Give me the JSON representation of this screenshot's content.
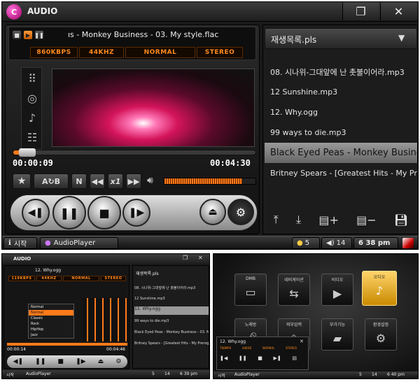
{
  "window": {
    "title": "AUDIO",
    "restore_icon": "restore-icon",
    "close_icon": "close-icon",
    "logo_text": "C"
  },
  "player": {
    "marquee": "ıs - Monkey Business - 03. My style.flac",
    "bitrate": "860KBPS",
    "samplerate": "44KHZ",
    "eq": "NORMAL",
    "channel": "STEREO",
    "time_elapsed": "00:00:09",
    "time_total": "00:04:30",
    "progress": 0.035,
    "volume": 0.85,
    "repeat_label": "A↻B",
    "n_label": "N",
    "speed_label": "x1"
  },
  "playlist": {
    "name": "재생목록.pls",
    "items": [
      "08. 시나위-그대앞에 난 촛불이어라.mp3",
      "12 Sunshine.mp3",
      "12. Why.ogg",
      "99 ways to die.mp3",
      "Black Eyed Peas - Monkey Business",
      "Britney Spears - [Greatest Hits - My Prerogative"
    ],
    "selected_index": 4
  },
  "taskbar": {
    "start": "시작",
    "app": "AudioPlayer",
    "signal": "5",
    "volume": "14",
    "clock": "6 38 pm"
  },
  "small": {
    "title": "AUDIO",
    "marquee": "12. Why.ogg",
    "bitrate": "119KBPS",
    "samplerate": "44KHZ",
    "eq": "NORMAL",
    "channel": "STEREO",
    "eq_menu": [
      "Normal",
      "Normal",
      "Classic",
      "Rock",
      "HipHop",
      "Jazz"
    ],
    "time_elapsed": "00:00:14",
    "time_total": "00:04:46",
    "playlist_name": "재생목록.pls",
    "playlist_items": [
      "08. 시나위-그대앞에 난 촛불이어라.mp3",
      "12 Sunshine.mp3",
      "12. Why.ogg",
      "99 ways to die.mp3",
      "Black Eyed Peas - Monkey Business - 03. My st",
      "Britney Spears - [Greatest Hits - My Prerogative"
    ],
    "selected_index": 2,
    "taskbar": {
      "start": "시작",
      "app": "AudioPlayer",
      "signal": "5",
      "volume": "14",
      "clock": "6 39 pm"
    }
  },
  "menu": {
    "tiles": [
      {
        "label": "DMB",
        "icon": "tv-icon"
      },
      {
        "label": "네비게이션",
        "icon": "arrows-icon"
      },
      {
        "label": "비디오",
        "icon": "video-icon"
      },
      {
        "label": "오디오",
        "icon": "music-icon",
        "active": true
      },
      {
        "label": "노래방",
        "icon": "mic-icon"
      },
      {
        "label": "외부입력",
        "icon": "input-icon"
      },
      {
        "label": "부가기능",
        "icon": "folder-icon"
      },
      {
        "label": "환경설정",
        "icon": "gear-icon"
      }
    ],
    "mini_marquee": "12. Why.ogg",
    "mini_info": [
      "TKBMPS",
      "44KHZ",
      "NORMAL",
      "STEREO"
    ],
    "taskbar": {
      "start": "시작",
      "app": "AudioPlayer",
      "signal": "5",
      "volume": "14",
      "clock": "6 40 pm"
    }
  }
}
